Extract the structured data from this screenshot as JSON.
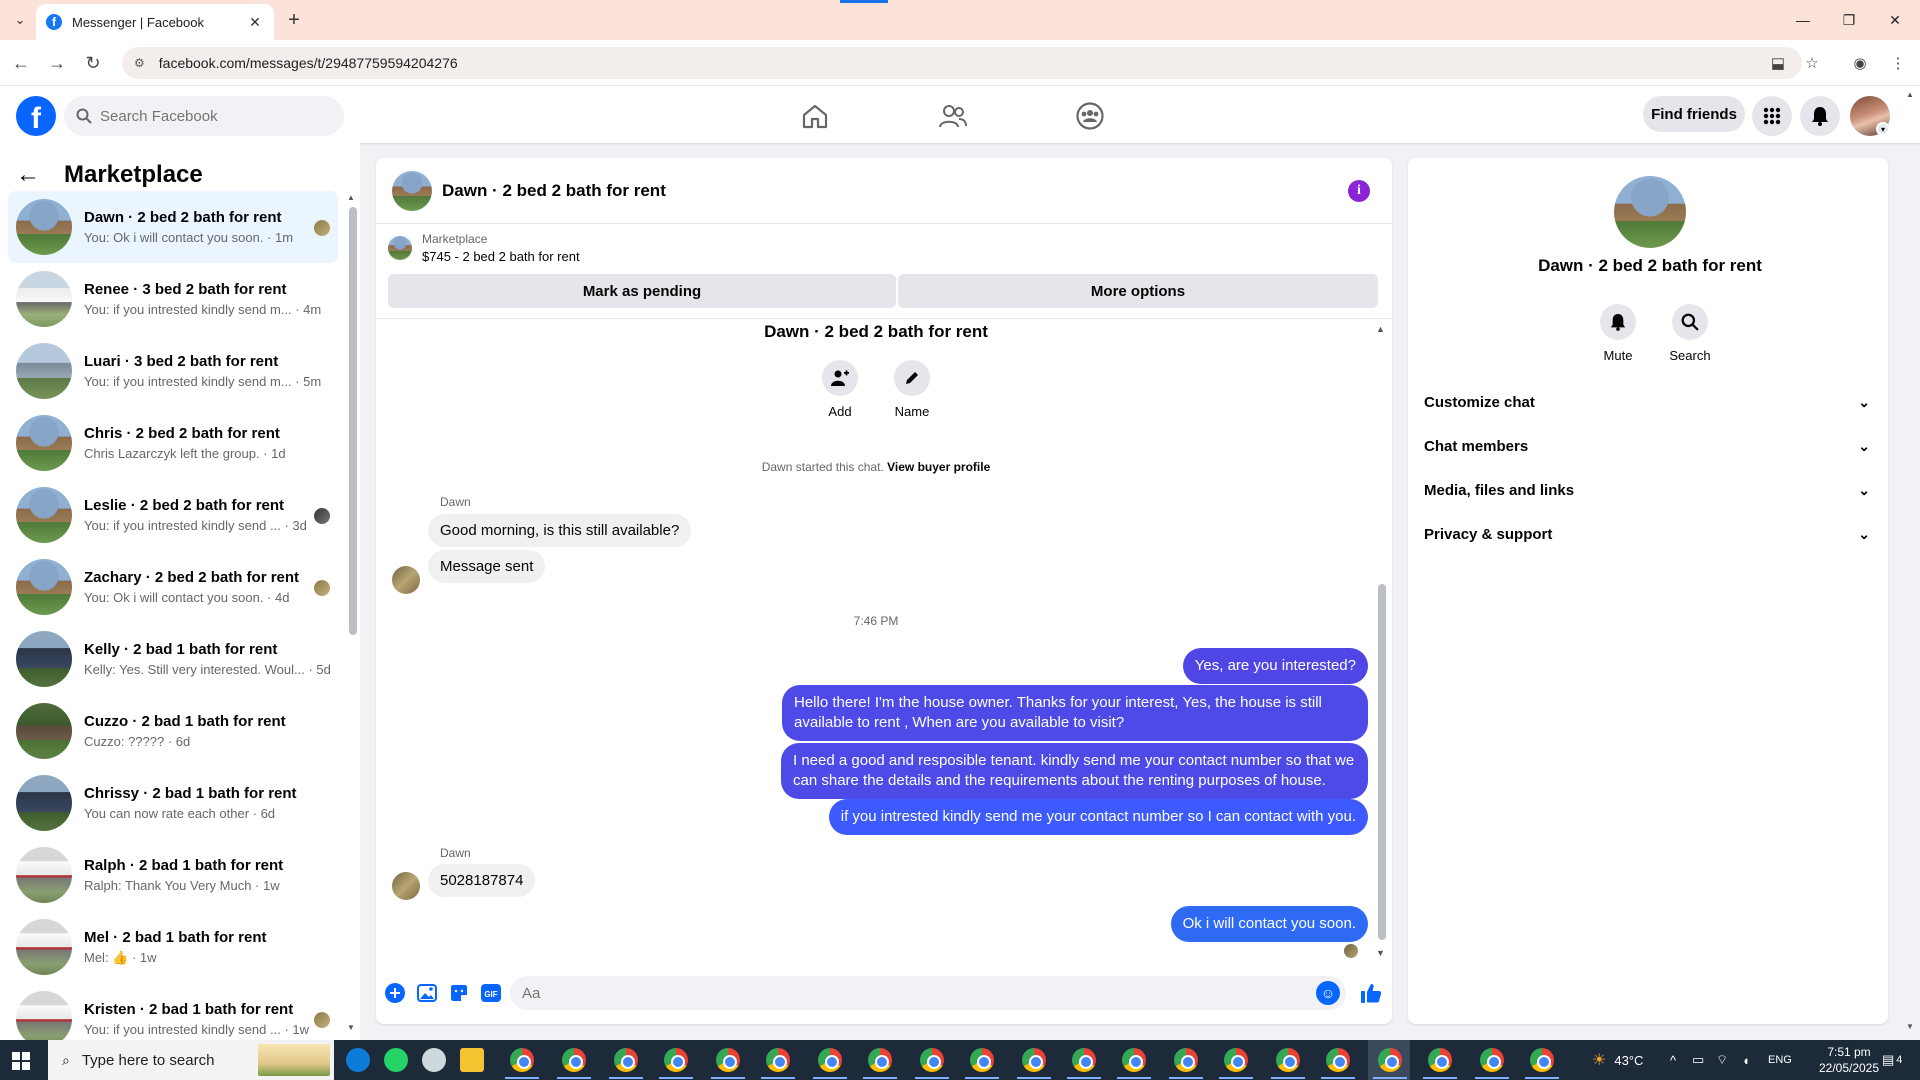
{
  "browser": {
    "tab_title": "Messenger | Facebook",
    "url": "facebook.com/messages/t/29487759594204276"
  },
  "fb": {
    "search_placeholder": "Search Facebook",
    "find_friends": "Find friends"
  },
  "left": {
    "title": "Marketplace",
    "conversations": [
      {
        "name": "Dawn · 2 bed 2 bath for rent",
        "snippet": "You: Ok i will contact you soon. · 1m",
        "thumb": "green",
        "seen": "light",
        "active": true
      },
      {
        "name": "Renee · 3 bed 2 bath for rent",
        "snippet": "You: if you intrested kindly send m... · 4m",
        "thumb": "white",
        "seen": "",
        "active": false
      },
      {
        "name": "Luari · 3 bed 2 bath for rent",
        "snippet": "You: if you intrested kindly send m... · 5m",
        "thumb": "gray",
        "seen": "",
        "active": false
      },
      {
        "name": "Chris · 2 bed 2 bath for rent",
        "snippet": "Chris Lazarczyk left the group. · 1d",
        "thumb": "green",
        "seen": "",
        "active": false
      },
      {
        "name": "Leslie · 2 bed 2 bath for rent",
        "snippet": "You: if you intrested kindly send ... · 3d",
        "thumb": "green",
        "seen": "dark",
        "active": false
      },
      {
        "name": "Zachary · 2 bed 2 bath for rent",
        "snippet": "You: Ok i will contact you soon. · 4d",
        "thumb": "green",
        "seen": "light",
        "active": false
      },
      {
        "name": "Kelly · 2 bad 1 bath for rent",
        "snippet": "Kelly: Yes. Still very interested. Woul... · 5d",
        "thumb": "dark",
        "seen": "",
        "active": false
      },
      {
        "name": "Cuzzo · 2 bad 1 bath for rent",
        "snippet": "Cuzzo: ????? · 6d",
        "thumb": "forest",
        "seen": "",
        "active": false
      },
      {
        "name": "Chrissy · 2 bad 1 bath for rent",
        "snippet": "You can now rate each other · 6d",
        "thumb": "dark",
        "seen": "",
        "active": false
      },
      {
        "name": "Ralph · 2 bad 1 bath for rent",
        "snippet": "Ralph: Thank You Very Much · 1w",
        "thumb": "mono",
        "seen": "",
        "active": false
      },
      {
        "name": "Mel · 2 bad 1 bath for rent",
        "snippet": "Mel: 👍 · 1w",
        "thumb": "mono",
        "seen": "",
        "active": false
      },
      {
        "name": "Kristen · 2 bad 1 bath for rent",
        "snippet": "You: if you intrested kindly send ... · 1w",
        "thumb": "mono",
        "seen": "light",
        "active": false
      }
    ]
  },
  "chat": {
    "title": "Dawn · 2 bed 2 bath for rent",
    "marketplace_label": "Marketplace",
    "listing": "$745 - 2 bed 2 bath for rent",
    "mark_pending": "Mark as pending",
    "more_options": "More options",
    "intro_title": "Dawn · 2 bed 2 bath for rent",
    "add_label": "Add",
    "name_label": "Name",
    "system_message": "Dawn started this chat.",
    "view_buyer_profile": "View buyer profile",
    "sender": "Dawn",
    "msg_in_1": "Good morning, is this still available?",
    "msg_in_2": "Message sent",
    "time": "7:46 PM",
    "msg_out_1": "Yes, are you interested?",
    "msg_out_2": "Hello there! I'm the house owner. Thanks for your interest, Yes, the house is still available to rent , When are you available to visit?",
    "msg_out_3": "I need a good and resposible tenant.  kindly send me your contact number so that we can share the details and the requirements about the renting purposes of house.",
    "msg_out_4": "if you intrested kindly send me your contact number so I can contact with you.",
    "sender_2": "Dawn",
    "msg_in_3": "5028187874",
    "msg_out_5": "Ok i will contact you soon.",
    "composer_placeholder": "Aa"
  },
  "details": {
    "name": "Dawn · 2 bed 2 bath for rent",
    "mute": "Mute",
    "search": "Search",
    "sections": [
      "Customize chat",
      "Chat members",
      "Media, files and links",
      "Privacy & support"
    ]
  },
  "taskbar": {
    "search_placeholder": "Type here to search",
    "temperature": "43°C",
    "language": "ENG",
    "time": "7:51 pm",
    "date": "22/05/2025",
    "notifications": "4"
  },
  "colors": {
    "fb_blue": "#0866ff",
    "outgoing_bubble": "#4f46e5",
    "info_purple": "#8b23d6"
  }
}
